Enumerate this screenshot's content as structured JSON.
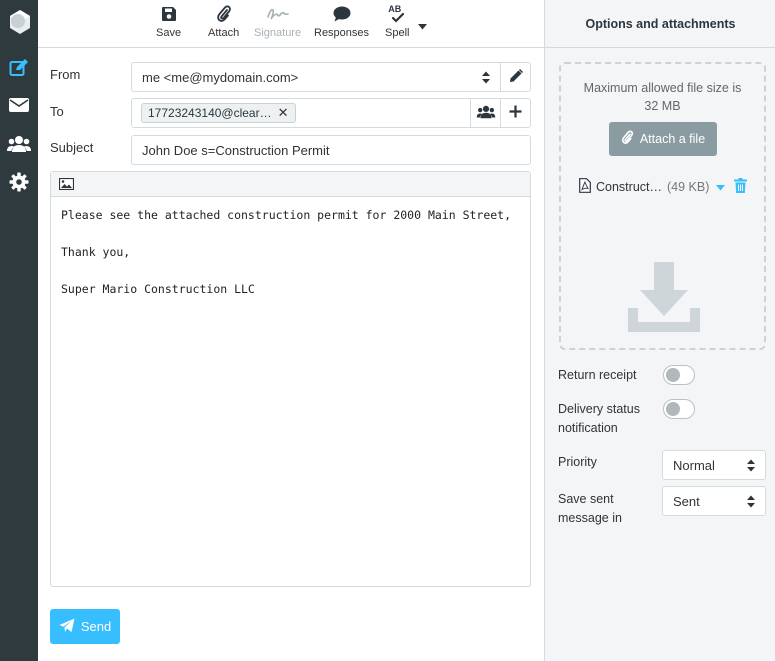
{
  "toolbar": {
    "save": "Save",
    "attach": "Attach",
    "signature": "Signature",
    "responses": "Responses",
    "spell": "Spell",
    "spell_glyph": "AB"
  },
  "form": {
    "from_label": "From",
    "from_value": "me <me@mydomain.com>",
    "to_label": "To",
    "to_recipient": "17723243140@clear…",
    "subject_label": "Subject",
    "subject_value": "John Doe s=Construction Permit"
  },
  "message": {
    "body": "Please see the attached construction permit for 2000 Main Street,\n\nThank you,\n\nSuper Mario Construction LLC"
  },
  "send_label": "Send",
  "options": {
    "title": "Options and attachments",
    "max_size": "Maximum allowed file size is 32 MB",
    "attach_button": "Attach a file",
    "attachment": {
      "name": "Construct…",
      "size": "(49 KB)"
    },
    "return_receipt": "Return receipt",
    "delivery_status": "Delivery status notification",
    "priority_label": "Priority",
    "priority_value": "Normal",
    "save_sent_label": "Save sent message in",
    "save_sent_value": "Sent"
  },
  "colors": {
    "rail": "#2f3a3f",
    "accent": "#37beff",
    "muted_button": "#8a9ba1"
  },
  "icons": {
    "rail": [
      "logo-icon",
      "compose-icon",
      "mail-icon",
      "contacts-icon",
      "settings-icon"
    ],
    "toolbar": [
      "save-icon",
      "paperclip-icon",
      "signature-icon",
      "responses-icon",
      "spellcheck-icon"
    ]
  }
}
